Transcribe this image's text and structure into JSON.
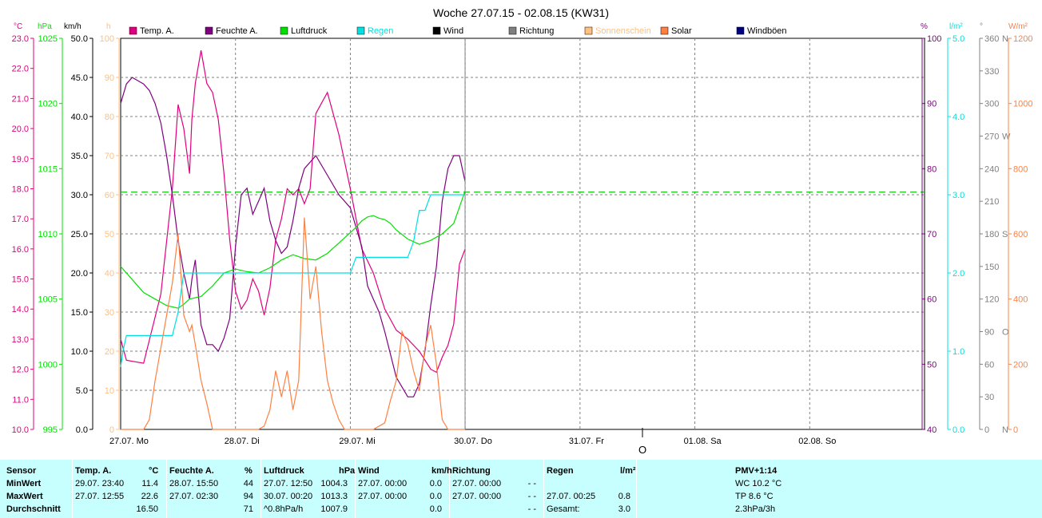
{
  "title": "Woche 27.07.15 - 02.08.15 (KW31)",
  "colors": {
    "temp": "#e0007f",
    "humidity": "#7f007f",
    "pressure": "#00e000",
    "rain": "#00e0e0",
    "wind": "#000000",
    "direction": "#7f7f7f",
    "sunshine": "#ffc080",
    "solar": "#ff8040",
    "gusts": "#00007f",
    "dashed": "#00c000",
    "table_bg": "#c7ffff"
  },
  "left_axes": {
    "temp": {
      "unit": "°C",
      "ticks": [
        "23.0",
        "22.0",
        "21.0",
        "20.0",
        "19.0",
        "18.0",
        "17.0",
        "16.0",
        "15.0",
        "14.0",
        "13.0",
        "12.0",
        "11.0",
        "10.0"
      ]
    },
    "pressure": {
      "unit": "hPa",
      "ticks": [
        "1025",
        "1020",
        "1015",
        "1010",
        "1005",
        "1000",
        "995"
      ]
    },
    "wind": {
      "unit": "km/h",
      "ticks": [
        "50.0",
        "45.0",
        "40.0",
        "35.0",
        "30.0",
        "25.0",
        "20.0",
        "15.0",
        "10.0",
        "5.0",
        "0.0"
      ]
    },
    "sunshine": {
      "unit": "h",
      "ticks": [
        "100",
        "90",
        "80",
        "70",
        "60",
        "50",
        "40",
        "30",
        "20",
        "10",
        "0"
      ]
    }
  },
  "right_axes": {
    "humidity": {
      "unit": "%",
      "ticks": [
        "100",
        "90",
        "80",
        "70",
        "60",
        "50",
        "40"
      ]
    },
    "rain": {
      "unit": "l/m²",
      "ticks": [
        "5.0",
        "4.0",
        "3.0",
        "2.0",
        "1.0",
        "0.0"
      ]
    },
    "direction": {
      "unit": "°",
      "ticks": [
        "360",
        "330",
        "300",
        "270",
        "240",
        "210",
        "180",
        "150",
        "120",
        "90",
        "60",
        "30",
        "0"
      ],
      "compass": [
        "N",
        "",
        "",
        "W",
        "",
        "",
        "S",
        "",
        "",
        "O",
        "",
        "",
        "N"
      ]
    },
    "solar": {
      "unit": "W/m²",
      "ticks": [
        "1200",
        "1000",
        "800",
        "600",
        "400",
        "200",
        "0"
      ]
    }
  },
  "legend": [
    {
      "label": "Temp. A.",
      "color": "#e0007f"
    },
    {
      "label": "Feuchte A.",
      "color": "#7f007f"
    },
    {
      "label": "Luftdruck",
      "color": "#00e000"
    },
    {
      "label": "Regen",
      "color": "#00e0e0"
    },
    {
      "label": "Wind",
      "color": "#000000"
    },
    {
      "label": "Richtung",
      "color": "#7f7f7f"
    },
    {
      "label": "Sonnenschein",
      "color": "#ffc080"
    },
    {
      "label": "Solar",
      "color": "#ff8040"
    },
    {
      "label": "Windböen",
      "color": "#00007f"
    }
  ],
  "x_labels": [
    "27.07. Mo",
    "28.07. Di",
    "29.07. Mi",
    "30.07. Do",
    "31.07. Fr",
    "01.08. Sa",
    "02.08. So"
  ],
  "now_marker": "O",
  "chart_data": {
    "type": "line",
    "x_unit": "days since 27.07. 00:00",
    "x_range": [
      0,
      7
    ],
    "series": [
      {
        "name": "Temp. A.",
        "axis": "temp",
        "ylim": [
          10,
          23
        ],
        "x": [
          0,
          0.05,
          0.2,
          0.35,
          0.45,
          0.5,
          0.55,
          0.6,
          0.62,
          0.65,
          0.7,
          0.75,
          0.8,
          0.85,
          0.9,
          0.95,
          1.0,
          1.05,
          1.1,
          1.15,
          1.2,
          1.25,
          1.3,
          1.35,
          1.4,
          1.45,
          1.5,
          1.55,
          1.6,
          1.65,
          1.7,
          1.8,
          1.9,
          2.0,
          2.1,
          2.2,
          2.3,
          2.4,
          2.5,
          2.6,
          2.7,
          2.75,
          2.8,
          2.85,
          2.9,
          2.95,
          3.0
        ],
        "y": [
          13.0,
          12.3,
          12.2,
          14.5,
          18.0,
          20.8,
          20.0,
          18.5,
          20.3,
          21.5,
          22.6,
          21.5,
          21.2,
          20.3,
          18.5,
          16.3,
          14.6,
          14.0,
          14.3,
          15.0,
          14.6,
          13.8,
          14.7,
          16.3,
          17.0,
          18.0,
          17.8,
          18.0,
          17.5,
          18.0,
          20.5,
          21.2,
          19.8,
          18.0,
          16.0,
          15.2,
          14.0,
          13.3,
          13.0,
          12.6,
          12.0,
          11.9,
          12.4,
          12.8,
          13.5,
          15.5,
          16.0
        ]
      },
      {
        "name": "Feuchte A.",
        "axis": "humidity",
        "ylim": [
          40,
          100
        ],
        "x": [
          0,
          0.05,
          0.1,
          0.15,
          0.2,
          0.25,
          0.3,
          0.35,
          0.4,
          0.45,
          0.5,
          0.55,
          0.6,
          0.62,
          0.65,
          0.7,
          0.75,
          0.8,
          0.85,
          0.9,
          0.95,
          1.0,
          1.05,
          1.1,
          1.15,
          1.2,
          1.25,
          1.3,
          1.35,
          1.4,
          1.45,
          1.5,
          1.55,
          1.6,
          1.7,
          1.8,
          1.9,
          2.0,
          2.1,
          2.15,
          2.2,
          2.25,
          2.3,
          2.4,
          2.5,
          2.55,
          2.6,
          2.65,
          2.7,
          2.75,
          2.8,
          2.85,
          2.9,
          2.95,
          3.0
        ],
        "y": [
          90,
          93,
          94,
          93.5,
          93,
          92,
          90,
          87,
          82,
          76,
          69,
          64,
          60,
          63,
          66,
          56,
          53,
          53,
          52,
          54,
          57,
          68,
          76,
          77,
          73,
          75,
          77,
          72,
          69,
          67,
          68,
          72,
          77,
          80,
          82,
          79,
          76,
          74,
          68,
          62,
          60,
          58,
          55,
          48,
          45,
          45,
          47,
          52,
          59,
          65,
          75,
          80,
          82,
          82,
          78
        ]
      },
      {
        "name": "Luftdruck",
        "axis": "pressure",
        "ylim": [
          995,
          1025
        ],
        "x": [
          0,
          0.05,
          0.1,
          0.2,
          0.3,
          0.4,
          0.5,
          0.55,
          0.6,
          0.7,
          0.8,
          0.9,
          1.0,
          1.1,
          1.2,
          1.3,
          1.4,
          1.5,
          1.6,
          1.7,
          1.8,
          1.9,
          2.0,
          2.05,
          2.1,
          2.15,
          2.2,
          2.25,
          2.3,
          2.35,
          2.4,
          2.5,
          2.6,
          2.7,
          2.8,
          2.9,
          3.0
        ],
        "y": [
          1007.5,
          1007,
          1006.5,
          1005.5,
          1005,
          1004.5,
          1004.3,
          1004.6,
          1005,
          1005.2,
          1006,
          1007,
          1007.3,
          1007.1,
          1007,
          1007.4,
          1008,
          1008.4,
          1008.1,
          1008,
          1008.5,
          1009.3,
          1010.1,
          1010.5,
          1011,
          1011.3,
          1011.4,
          1011.2,
          1011.1,
          1010.8,
          1010.3,
          1009.6,
          1009.2,
          1009.5,
          1010,
          1010.8,
          1013.3
        ]
      },
      {
        "name": "Regen",
        "axis": "rain",
        "ylim": [
          0,
          5
        ],
        "x": [
          0,
          0.02,
          0.05,
          0.1,
          0.4,
          0.45,
          0.5,
          0.55,
          0.6,
          1.0,
          1.5,
          2.0,
          2.05,
          2.5,
          2.55,
          2.6,
          2.65,
          2.7,
          2.75,
          2.8,
          2.85,
          3.0
        ],
        "y": [
          0.8,
          1.0,
          1.2,
          1.2,
          1.2,
          1.2,
          1.5,
          2.0,
          2.0,
          2.0,
          2.0,
          2.0,
          2.2,
          2.2,
          2.4,
          2.8,
          2.8,
          3.0,
          3.0,
          3.0,
          3.0,
          3.0
        ]
      },
      {
        "name": "Solar",
        "axis": "solar",
        "ylim": [
          0,
          1200
        ],
        "x": [
          0,
          0.2,
          0.25,
          0.3,
          0.35,
          0.4,
          0.45,
          0.5,
          0.52,
          0.55,
          0.6,
          0.62,
          0.65,
          0.7,
          0.75,
          0.8,
          0.85,
          0.9,
          0.95,
          1.0,
          1.2,
          1.25,
          1.3,
          1.35,
          1.4,
          1.45,
          1.5,
          1.55,
          1.6,
          1.65,
          1.7,
          1.75,
          1.8,
          1.85,
          1.9,
          1.95,
          2.0,
          2.2,
          2.3,
          2.35,
          2.4,
          2.45,
          2.5,
          2.55,
          2.6,
          2.65,
          2.7,
          2.75,
          2.8,
          2.85,
          2.9,
          3.0
        ],
        "y": [
          0,
          0,
          30,
          150,
          250,
          350,
          450,
          600,
          500,
          350,
          300,
          320,
          260,
          150,
          80,
          0,
          0,
          0,
          0,
          0,
          0,
          10,
          60,
          180,
          100,
          180,
          60,
          150,
          650,
          400,
          500,
          300,
          150,
          80,
          30,
          0,
          0,
          0,
          20,
          90,
          150,
          300,
          260,
          180,
          120,
          250,
          320,
          200,
          30,
          0,
          0,
          0
        ]
      },
      {
        "name": "Dashed",
        "axis": "pressure",
        "ylim": [
          995,
          1025
        ],
        "x": [
          0,
          7
        ],
        "y": [
          1013.2,
          1013.2
        ]
      }
    ]
  },
  "table": {
    "headers": [
      {
        "label": "Sensor",
        "unit": ""
      },
      {
        "label": "Temp. A.",
        "unit": "°C"
      },
      {
        "label": "Feuchte A.",
        "unit": "%"
      },
      {
        "label": "Luftdruck",
        "unit": "hPa"
      },
      {
        "label": "Wind",
        "unit": "km/h"
      },
      {
        "label": "Richtung",
        "unit": ""
      },
      {
        "label": "Regen",
        "unit": "l/m²"
      },
      {
        "label": "PMV+1:14",
        "unit": ""
      }
    ],
    "rows": [
      {
        "name": "MinWert",
        "temp": {
          "time": "29.07.  23:40",
          "value": "11.4"
        },
        "hum": {
          "time": "28.07.  15:50",
          "value": "44"
        },
        "press": {
          "time": "27.07.  12:50",
          "value": "1004.3"
        },
        "wind": {
          "time": "27.07.  00:00",
          "value": "0.0"
        },
        "dir": {
          "time": "27.07.  00:00",
          "value": "- -"
        },
        "rain": {
          "time": "",
          "value": ""
        },
        "pmv": "WC 10.2 °C"
      },
      {
        "name": "MaxWert",
        "temp": {
          "time": "27.07.  12:55",
          "value": "22.6"
        },
        "hum": {
          "time": "27.07.  02:30",
          "value": "94"
        },
        "press": {
          "time": "30.07.  00:20",
          "value": "1013.3"
        },
        "wind": {
          "time": "27.07.  00:00",
          "value": "0.0"
        },
        "dir": {
          "time": "27.07.  00:00",
          "value": "- -"
        },
        "rain": {
          "time": "27.07.  00:25",
          "value": "0.8"
        },
        "pmv": "TP 8.6 °C"
      },
      {
        "name": "Durchschnitt",
        "temp": {
          "time": "",
          "value": "16.50"
        },
        "hum": {
          "time": "",
          "value": "71"
        },
        "press": {
          "time": "^0.8hPa/h",
          "value": "1007.9"
        },
        "wind": {
          "time": "",
          "value": "0.0"
        },
        "dir": {
          "time": "",
          "value": "- -"
        },
        "rain": {
          "time": "Gesamt:",
          "value": "3.0"
        },
        "pmv": "2.3hPa/3h"
      }
    ]
  }
}
